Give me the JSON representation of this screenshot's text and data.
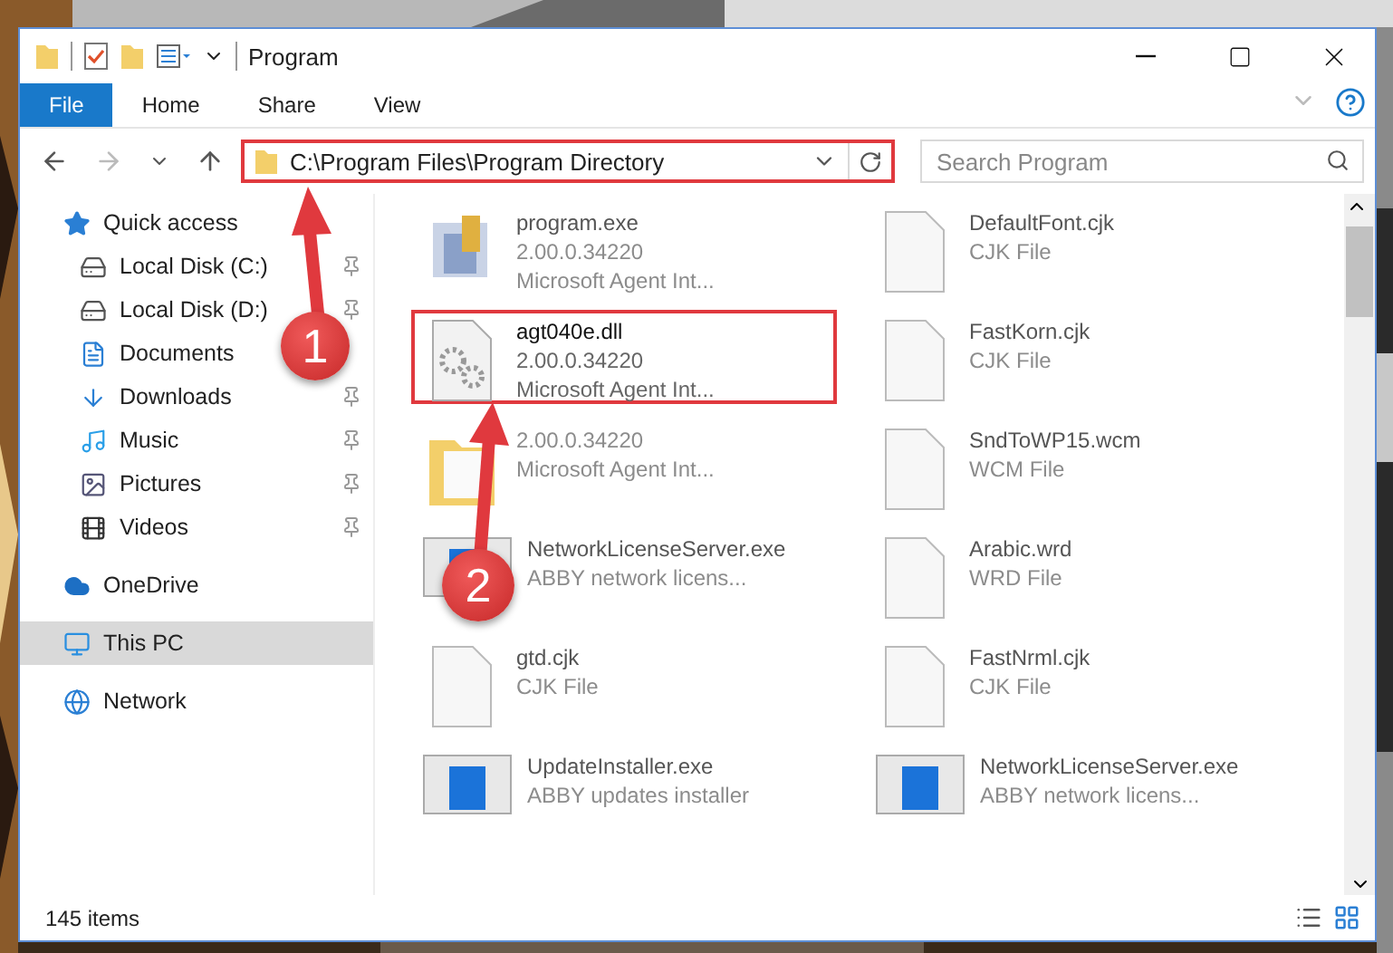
{
  "window": {
    "title": "Program"
  },
  "ribbon": {
    "tabs": [
      {
        "label": "File",
        "selected": true
      },
      {
        "label": "Home",
        "selected": false
      },
      {
        "label": "Share",
        "selected": false
      },
      {
        "label": "View",
        "selected": false
      }
    ]
  },
  "address_bar": {
    "path": "C:\\Program Files\\Program Directory",
    "highlighted": true
  },
  "search": {
    "placeholder": "Search Program"
  },
  "sidebar": {
    "items": [
      {
        "label": "Quick access",
        "kind": "star",
        "selected": false,
        "children": [
          {
            "label": "Local Disk (C:)",
            "kind": "drive-c",
            "pinned": true,
            "selected": false
          },
          {
            "label": "Local Disk (D:)",
            "kind": "drive",
            "pinned": true,
            "selected": false
          },
          {
            "label": "Documents",
            "kind": "document",
            "pinned": false,
            "selected": false
          },
          {
            "label": "Downloads",
            "kind": "download",
            "pinned": true,
            "selected": false
          },
          {
            "label": "Music",
            "kind": "music",
            "pinned": true,
            "selected": false
          },
          {
            "label": "Pictures",
            "kind": "pictures",
            "pinned": true,
            "selected": false
          },
          {
            "label": "Videos",
            "kind": "video",
            "pinned": true,
            "selected": false
          }
        ]
      },
      {
        "label": "OneDrive",
        "kind": "cloud",
        "selected": false
      },
      {
        "label": "This PC",
        "kind": "pc",
        "selected": true
      },
      {
        "label": "Network",
        "kind": "network",
        "selected": false
      }
    ]
  },
  "files": [
    {
      "kind": "app",
      "name": "program.exe",
      "lines": [
        "2.00.0.34220",
        "Microsoft Agent Int..."
      ],
      "highlighted": false,
      "blurred": true
    },
    {
      "kind": "blank",
      "name": "DefaultFont.cjk",
      "lines": [
        "CJK File"
      ],
      "highlighted": false,
      "blurred": true
    },
    {
      "kind": "dll",
      "name": "agt040e.dll",
      "lines": [
        "2.00.0.34220",
        "Microsoft Agent Int..."
      ],
      "highlighted": true,
      "blurred": false
    },
    {
      "kind": "blank",
      "name": "FastKorn.cjk",
      "lines": [
        "CJK File"
      ],
      "highlighted": false,
      "blurred": true
    },
    {
      "kind": "folder",
      "lines": [
        "2.00.0.34220",
        "Microsoft Agent Int..."
      ],
      "highlighted": false,
      "blurred": true
    },
    {
      "kind": "blank",
      "name": "SndToWP15.wcm",
      "lines": [
        "WCM File"
      ],
      "highlighted": false,
      "blurred": true
    },
    {
      "kind": "window",
      "name": "NetworkLicenseServer.exe",
      "lines": [
        "ABBY network licens..."
      ],
      "highlighted": false,
      "blurred": true
    },
    {
      "kind": "blank",
      "name": "Arabic.wrd",
      "lines": [
        "WRD File"
      ],
      "highlighted": false,
      "blurred": true
    },
    {
      "kind": "blank",
      "name": "gtd.cjk",
      "lines": [
        "CJK File"
      ],
      "highlighted": false,
      "blurred": true
    },
    {
      "kind": "blank",
      "name": "FastNrml.cjk",
      "lines": [
        "CJK File"
      ],
      "highlighted": false,
      "blurred": true
    },
    {
      "kind": "window",
      "name": "UpdateInstaller.exe",
      "lines": [
        "ABBY updates installer"
      ],
      "highlighted": false,
      "blurred": true
    },
    {
      "kind": "window",
      "name": "NetworkLicenseServer.exe",
      "lines": [
        "ABBY network licens..."
      ],
      "highlighted": false,
      "blurred": true
    }
  ],
  "status_bar": {
    "item_count": "145 items"
  },
  "annotations": [
    {
      "number": "1"
    },
    {
      "number": "2"
    }
  ]
}
